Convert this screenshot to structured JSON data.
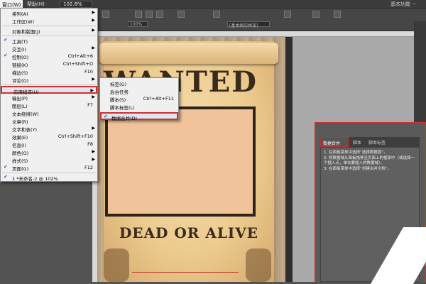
{
  "menubar": {
    "window_menu": "窗口(W)",
    "help_menu": "帮助(H)",
    "zoom": "102.8%",
    "workspace": "基本功能",
    "minimize": "–"
  },
  "controlbar": {
    "percent": "100%",
    "style_field": "[基本图形框架]"
  },
  "menu": {
    "items": [
      {
        "label": "排列(A)",
        "shortcut": "",
        "submenu": true,
        "checked": false
      },
      {
        "label": "工作区(W)",
        "shortcut": "",
        "submenu": true,
        "checked": false
      },
      {
        "label": "对象和版面(J)",
        "shortcut": "",
        "submenu": true,
        "checked": false
      },
      {
        "label": "工具(T)",
        "shortcut": "",
        "submenu": false,
        "checked": true
      },
      {
        "label": "交互(I)",
        "shortcut": "",
        "submenu": true,
        "checked": false
      },
      {
        "label": "控制(O)",
        "shortcut": "Ctrl+Alt+6",
        "submenu": false,
        "checked": true
      },
      {
        "label": "链接(K)",
        "shortcut": "Ctrl+Shift+D",
        "submenu": false,
        "checked": false
      },
      {
        "label": "描边(S)",
        "shortcut": "F10",
        "submenu": false,
        "checked": false
      },
      {
        "label": "评论(O)",
        "shortcut": "",
        "submenu": true,
        "checked": false
      },
      {
        "label": "实用程序(U)",
        "shortcut": "",
        "submenu": true,
        "checked": false
      },
      {
        "label": "输出(P)",
        "shortcut": "",
        "submenu": true,
        "checked": false
      },
      {
        "label": "图层(L)",
        "shortcut": "F7",
        "submenu": false,
        "checked": false
      },
      {
        "label": "文本绕排(W)",
        "shortcut": "",
        "submenu": false,
        "checked": false
      },
      {
        "label": "文章(R)",
        "shortcut": "",
        "submenu": false,
        "checked": false
      },
      {
        "label": "文字和表(Y)",
        "shortcut": "",
        "submenu": true,
        "checked": false
      },
      {
        "label": "效果(E)",
        "shortcut": "Ctrl+Shift+F10",
        "submenu": false,
        "checked": false
      },
      {
        "label": "信息(I)",
        "shortcut": "F8",
        "submenu": false,
        "checked": false
      },
      {
        "label": "颜色(O)",
        "shortcut": "",
        "submenu": true,
        "checked": false
      },
      {
        "label": "样式(S)",
        "shortcut": "",
        "submenu": true,
        "checked": false
      },
      {
        "label": "页面(G)",
        "shortcut": "F12",
        "submenu": false,
        "checked": true
      },
      {
        "label": "1 *未命名-2 @ 102%",
        "shortcut": "",
        "submenu": false,
        "checked": true
      }
    ]
  },
  "submenu": {
    "items": [
      {
        "label": "标签(G)",
        "shortcut": "",
        "checked": false
      },
      {
        "label": "后台任务",
        "shortcut": "",
        "checked": false
      },
      {
        "label": "脚本(S)",
        "shortcut": "Ctrl+Alt+F11",
        "checked": false
      },
      {
        "label": "脚本标签(L)",
        "shortcut": "",
        "checked": false
      },
      {
        "label": "数据合并(D)",
        "shortcut": "",
        "checked": true
      }
    ]
  },
  "document": {
    "headline": "WANTED",
    "subline": "DEAD OR ALIVE"
  },
  "data_merge_panel": {
    "tabs": [
      "数据合并",
      "脚本",
      "脚本标签"
    ],
    "steps": [
      "1. 在面板菜单中选择“选择数据源”。",
      "2. 将数据域从面板拖移至页面上的框架中（或选择一个插入点，单击要插入的数据域）。",
      "3. 在面板菜单中选择“创建合并文档”。"
    ]
  },
  "colors": {
    "highlight_border": "#d03030",
    "menu_bg": "#f0f0f0",
    "app_bg": "#535353"
  }
}
